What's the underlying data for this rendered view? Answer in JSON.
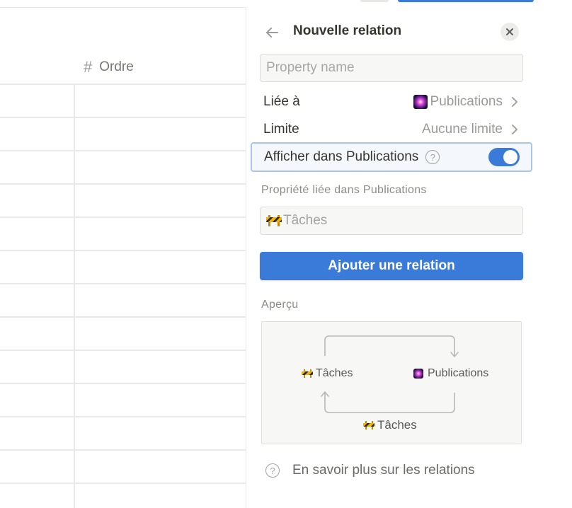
{
  "table": {
    "column_header": {
      "icon": "hash-icon",
      "label": "Ordre"
    }
  },
  "panel": {
    "title": "Nouvelle relation",
    "back_icon": "arrow-left-icon",
    "close_icon": "close-icon",
    "property_name": {
      "value": "",
      "placeholder": "Property name"
    },
    "related_to": {
      "label": "Liée à",
      "value": "Publications",
      "icon": "sparkles-emoji"
    },
    "limit": {
      "label": "Limite",
      "value": "Aucune limite"
    },
    "show_in": {
      "label": "Afficher dans Publications",
      "help_icon": "question-circle-icon",
      "enabled": true
    },
    "linked_property": {
      "section_label": "Propriété liée dans Publications",
      "value": "Tâches",
      "icon": "construction-emoji"
    },
    "add_button": "Ajouter une relation",
    "preview": {
      "section_label": "Aperçu",
      "left_db": "Tâches",
      "right_db": "Publications",
      "bottom_property": "Tâches"
    },
    "learn_more": "En savoir plus sur les relations"
  },
  "colors": {
    "accent": "#3a7ad8",
    "highlight_border": "#a9c5ee",
    "muted_text": "#9b9a97",
    "divider": "#e9e9e7"
  }
}
